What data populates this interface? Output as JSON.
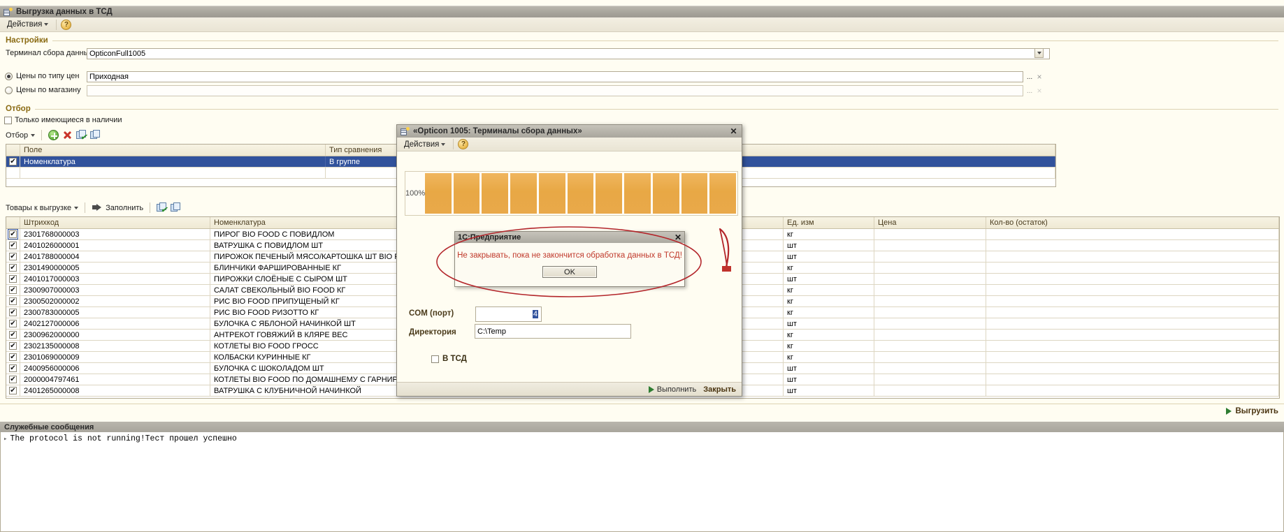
{
  "window": {
    "title": "Выгрузка данных в ТСД",
    "icon": "form-window-icon"
  },
  "menubar": {
    "actions_label": "Действия",
    "help_label": "?"
  },
  "settings": {
    "header": "Настройки",
    "terminal_label": "Терминал сбора данных:",
    "terminal_value": "OpticonFull1005",
    "price_by_type_label": "Цены по типу цен",
    "price_by_type_value": "Приходная",
    "price_by_shop_label": "Цены по магазину",
    "price_by_shop_value": "",
    "select_dots": "...",
    "clear_x": "×"
  },
  "filter": {
    "header": "Отбор",
    "only_in_stock_label": "Только имеющиеся в наличии",
    "only_in_stock_checked": false,
    "toolbar_label": "Отбор",
    "columns": [
      "Поле",
      "Тип сравнения"
    ],
    "rows": [
      {
        "checked": true,
        "field": "Номенклатура",
        "comparison": "В группе",
        "selected": true
      }
    ]
  },
  "goods": {
    "toolbar_label": "Товары к выгрузке",
    "fill_label": "Заполнить",
    "columns": [
      "Штрихкод",
      "Номенклатура",
      "Ед. изм",
      "Цена",
      "Кол-во (остаток)"
    ],
    "rows": [
      {
        "checked": true,
        "barcode": "2301768000003",
        "name": "ПИРОГ BIO FOOD С ПОВИДЛОМ",
        "unit": "кг",
        "price": "",
        "qty": ""
      },
      {
        "checked": true,
        "barcode": "2401026000001",
        "name": "ВАТРУШКА С ПОВИДЛОМ ШТ",
        "unit": "шт",
        "price": "",
        "qty": ""
      },
      {
        "checked": true,
        "barcode": "2401788000004",
        "name": "ПИРОЖОК ПЕЧЕНЫЙ МЯСО/КАРТОШКА ШТ BIO FOOD",
        "unit": "шт",
        "price": "",
        "qty": ""
      },
      {
        "checked": true,
        "barcode": "2301490000005",
        "name": "БЛИНЧИКИ ФАРШИРОВАННЫЕ КГ",
        "unit": "кг",
        "price": "",
        "qty": ""
      },
      {
        "checked": true,
        "barcode": "2401017000003",
        "name": "ПИРОЖКИ СЛОЁНЫЕ С СЫРОМ ШТ",
        "unit": "шт",
        "price": "",
        "qty": ""
      },
      {
        "checked": true,
        "barcode": "2300907000003",
        "name": "САЛАТ СВЕКОЛЬНЫЙ BIO FOOD КГ",
        "unit": "кг",
        "price": "",
        "qty": ""
      },
      {
        "checked": true,
        "barcode": "2300502000002",
        "name": "РИС BIO FOOD ПРИПУЩЕНЫЙ КГ",
        "unit": "кг",
        "price": "",
        "qty": ""
      },
      {
        "checked": true,
        "barcode": "2300783000005",
        "name": "РИС BIO FOOD РИЗОТТО КГ",
        "unit": "кг",
        "price": "",
        "qty": ""
      },
      {
        "checked": true,
        "barcode": "2402127000006",
        "name": "БУЛОЧКА С ЯБЛОНОЙ НАЧИНКОЙ ШТ",
        "unit": "шт",
        "price": "",
        "qty": ""
      },
      {
        "checked": true,
        "barcode": "2300962000000",
        "name": "АНТРЕКОТ ГОВЯЖИЙ В КЛЯРЕ ВЕС",
        "unit": "кг",
        "price": "",
        "qty": ""
      },
      {
        "checked": true,
        "barcode": "2302135000008",
        "name": "КОТЛЕТЫ BIO FOOD ГРОСС",
        "unit": "кг",
        "price": "",
        "qty": ""
      },
      {
        "checked": true,
        "barcode": "2301069000009",
        "name": "КОЛБАСКИ КУРИННЫЕ КГ",
        "unit": "кг",
        "price": "",
        "qty": ""
      },
      {
        "checked": true,
        "barcode": "2400956000006",
        "name": "БУЛОЧКА С ШОКОЛАДОМ ШТ",
        "unit": "шт",
        "price": "",
        "qty": ""
      },
      {
        "checked": true,
        "barcode": "2000004797461",
        "name": "КОТЛЕТЫ BIO FOOD ПО ДОМАШНЕМУ С ГАРНИРОМ",
        "unit": "шт",
        "price": "",
        "qty": ""
      },
      {
        "checked": true,
        "barcode": "2401265000008",
        "name": "ВАТРУШКА С КЛУБНИЧНОЙ НАЧИНКОЙ",
        "unit": "шт",
        "price": "",
        "qty": ""
      }
    ]
  },
  "bottom": {
    "upload_label": "Выгрузить"
  },
  "service_messages": {
    "header": "Служебные сообщения",
    "lines": [
      "The protocol is not running!Тест прошел успешно"
    ]
  },
  "opticon_dialog": {
    "title": "«Opticon 1005: Терминалы сбора данных»",
    "actions_label": "Действия",
    "help_label": "?",
    "close_label": "✕",
    "progress": {
      "label": "100%",
      "percent": 100,
      "segments": 11
    },
    "com_port_label": "COM (порт)",
    "com_port_value": "4",
    "directory_label": "Директория",
    "directory_value": "C:\\Temp",
    "to_tsd_label": "В ТСД",
    "to_tsd_checked": false,
    "execute_label": "Выполнить",
    "close_button_label": "Закрыть"
  },
  "message_box": {
    "title": "1С:Предприятие",
    "close_label": "✕",
    "text": "Не закрывать, пока не закончится обработка данных в ТСД!",
    "ok_label": "OK"
  },
  "colors": {
    "accent_orange": "#e9a94a",
    "header_gold": "#8a6a12",
    "selection_blue": "#31529c",
    "warning_red": "#c0392b",
    "annotation_red": "#b3252a"
  }
}
